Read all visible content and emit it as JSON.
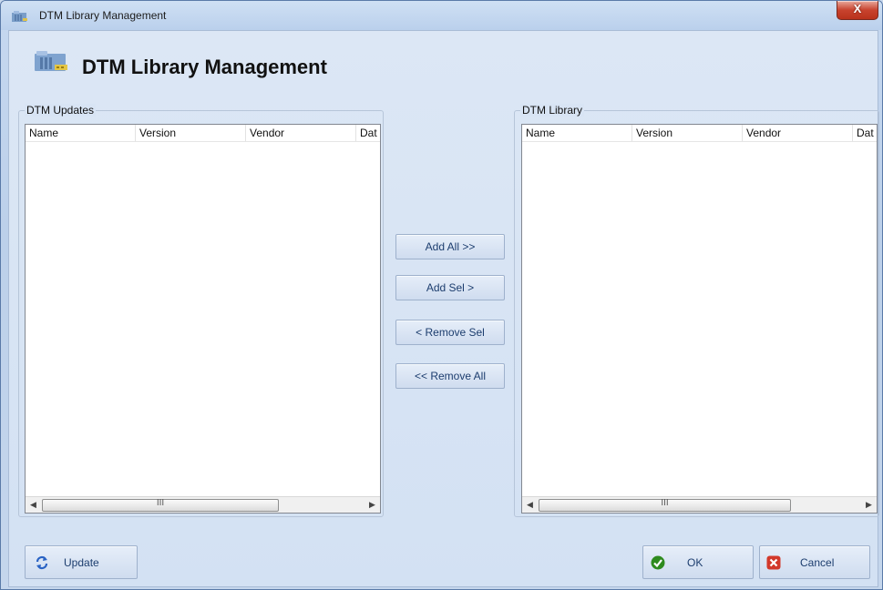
{
  "window": {
    "title": "DTM Library Management",
    "close_glyph": "X"
  },
  "header": {
    "title": "DTM Library Management",
    "icon": "library-folder-icon"
  },
  "updates": {
    "group_label": "DTM Updates",
    "columns": [
      "Name",
      "Version",
      "Vendor",
      "Dat"
    ],
    "rows": []
  },
  "library": {
    "group_label": "DTM Library",
    "columns": [
      "Name",
      "Version",
      "Vendor",
      "Dat"
    ],
    "rows": []
  },
  "scrollbar": {
    "left_arrow": "◀",
    "right_arrow": "▶",
    "grip": "III"
  },
  "transfer": {
    "add_all": "Add All >>",
    "add_sel": "Add Sel >",
    "remove_sel": "< Remove Sel",
    "remove_all": "<< Remove All"
  },
  "footer": {
    "update": "Update",
    "ok": "OK",
    "cancel": "Cancel"
  },
  "colors": {
    "accent": "#1c3d6e",
    "ok_icon": "#2e8b1e",
    "cancel_icon": "#d2382a",
    "refresh_icon": "#2a63c4"
  }
}
